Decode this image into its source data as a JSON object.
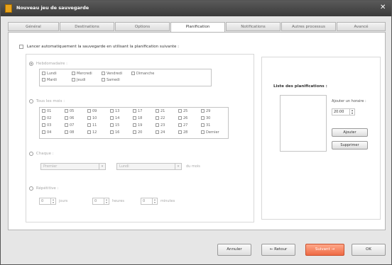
{
  "window": {
    "title": "Nouveau jeu de sauvegarde",
    "close_glyph": "✕"
  },
  "tabs": [
    "Général",
    "Destinations",
    "Options",
    "Planification",
    "Notifications",
    "Autres processus",
    "Avancé"
  ],
  "active_tab": 3,
  "schedule": {
    "auto_label": "Lancer automatiquement la sauvegarde en utilisant la planification suivante :",
    "weekly": {
      "label": "Hebdomadaire :",
      "days": [
        "Lundi",
        "Mercredi",
        "Vendredi",
        "Dimanche",
        "Mardi",
        "Jeudi",
        "Samedi"
      ]
    },
    "monthly": {
      "label": "Tous les mois :",
      "days": [
        "01",
        "05",
        "09",
        "13",
        "17",
        "21",
        "25",
        "29",
        "02",
        "06",
        "10",
        "14",
        "18",
        "22",
        "26",
        "30",
        "03",
        "07",
        "11",
        "15",
        "19",
        "23",
        "27",
        "31",
        "04",
        "08",
        "12",
        "16",
        "20",
        "24",
        "28",
        "Dernier"
      ]
    },
    "every": {
      "label": "Chaque :",
      "first": "Premier",
      "day": "Lundi",
      "suffix": "du mois"
    },
    "periodic": {
      "label": "Répétitive :",
      "units": [
        {
          "value": "0",
          "label": "jours"
        },
        {
          "value": "0",
          "label": "heures"
        },
        {
          "value": "0",
          "label": "minutes"
        }
      ]
    }
  },
  "schedule_list": {
    "title": "Liste des planifications :",
    "add_time_label": "Ajouter un horaire :",
    "time_value": "20:00",
    "add_button": "Ajouter",
    "delete_button": "Supprimer"
  },
  "footer": {
    "cancel": "Annuler",
    "back": "Retour",
    "next": "Suivant",
    "ok": "OK",
    "back_arrow": "←",
    "next_arrow": "→"
  }
}
